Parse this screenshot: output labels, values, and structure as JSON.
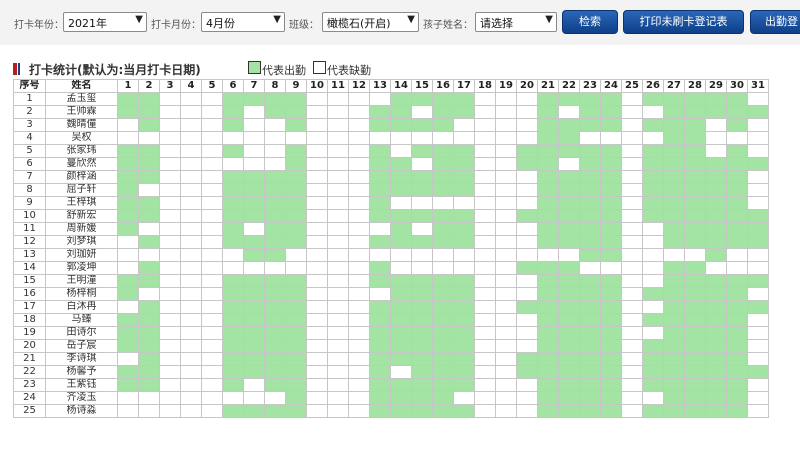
{
  "toolbar": {
    "year_label": "打卡年份：",
    "year_value": "2021年",
    "month_label": "打卡月份：",
    "month_value": "4月份",
    "class_label": "班级：",
    "class_value": "橄榄石(开启)",
    "child_label": "孩子姓名：",
    "child_value": "请选择",
    "search_button": "检索",
    "print_button": "打印未刷卡登记表",
    "attendance_button": "出勤登"
  },
  "stats": {
    "title": "打卡统计(默认为:当月打卡日期)",
    "legend_present": "代表出勤",
    "legend_absent": "代表缺勤",
    "present_color": "#a3e3a3",
    "absent_color": "#ffffff"
  },
  "table": {
    "headers": {
      "index": "序号",
      "name": "姓名"
    },
    "days": [
      "1",
      "2",
      "3",
      "4",
      "5",
      "6",
      "7",
      "8",
      "9",
      "10",
      "11",
      "12",
      "13",
      "14",
      "15",
      "16",
      "17",
      "18",
      "19",
      "20",
      "21",
      "22",
      "23",
      "24",
      "25",
      "26",
      "27",
      "28",
      "29",
      "30",
      "31"
    ],
    "rows": [
      {
        "index": "1",
        "name": "孟玉玺",
        "att": "1100011110000111100011110111110"
      },
      {
        "index": "2",
        "name": "王帅霖",
        "att": "1100010110001101100010110011111"
      },
      {
        "index": "3",
        "name": "魏晴僮",
        "att": "0100010010001111000011110111010"
      },
      {
        "index": "4",
        "name": "吴权",
        "att": "0000000000000000000011000011000"
      },
      {
        "index": "5",
        "name": "张家玮",
        "att": "1100010010001011100111110111010"
      },
      {
        "index": "6",
        "name": "蔓欣然",
        "att": "1100000010001101100110110111111"
      },
      {
        "index": "7",
        "name": "颜梓涵",
        "att": "1100011110001111100011110111110"
      },
      {
        "index": "8",
        "name": "屈子轩",
        "att": "1000011110001111100011110111110"
      },
      {
        "index": "9",
        "name": "王梓琪",
        "att": "1100011110001000000011110111110"
      },
      {
        "index": "10",
        "name": "舒新宏",
        "att": "1100011110001111100111110111111"
      },
      {
        "index": "11",
        "name": "周新媛",
        "att": "1000010110000101100011110011111"
      },
      {
        "index": "12",
        "name": "刘梦琪",
        "att": "0100011110001111100011110011111"
      },
      {
        "index": "13",
        "name": "刘珈妍",
        "att": "0000001100000000000000110000100"
      },
      {
        "index": "14",
        "name": "郭凌坤",
        "att": "0100000000001000000111000011000"
      },
      {
        "index": "15",
        "name": "王明潼",
        "att": "1100011110001111100011110011111"
      },
      {
        "index": "16",
        "name": "杨梓桐",
        "att": "1000011110000111100011110111110"
      },
      {
        "index": "17",
        "name": "白沐冉",
        "att": "0100011110001111100111110011111"
      },
      {
        "index": "18",
        "name": "马臻",
        "att": "1100011110001111100011110111110"
      },
      {
        "index": "19",
        "name": "田诗尔",
        "att": "1100011110001111100011110011110"
      },
      {
        "index": "20",
        "name": "岳子宸",
        "att": "1100011110001111100011110111110"
      },
      {
        "index": "21",
        "name": "李诗琪",
        "att": "0100011110001111100111110111110"
      },
      {
        "index": "22",
        "name": "杨馨予",
        "att": "1100011110001011100111110111111"
      },
      {
        "index": "23",
        "name": "王紫钰",
        "att": "1100010110001111100011110111110"
      },
      {
        "index": "24",
        "name": "齐凌玉",
        "att": "0000000010001111000011110011110"
      },
      {
        "index": "25",
        "name": "杨诗淼",
        "att": "0000011110001111100011110111110"
      }
    ]
  }
}
